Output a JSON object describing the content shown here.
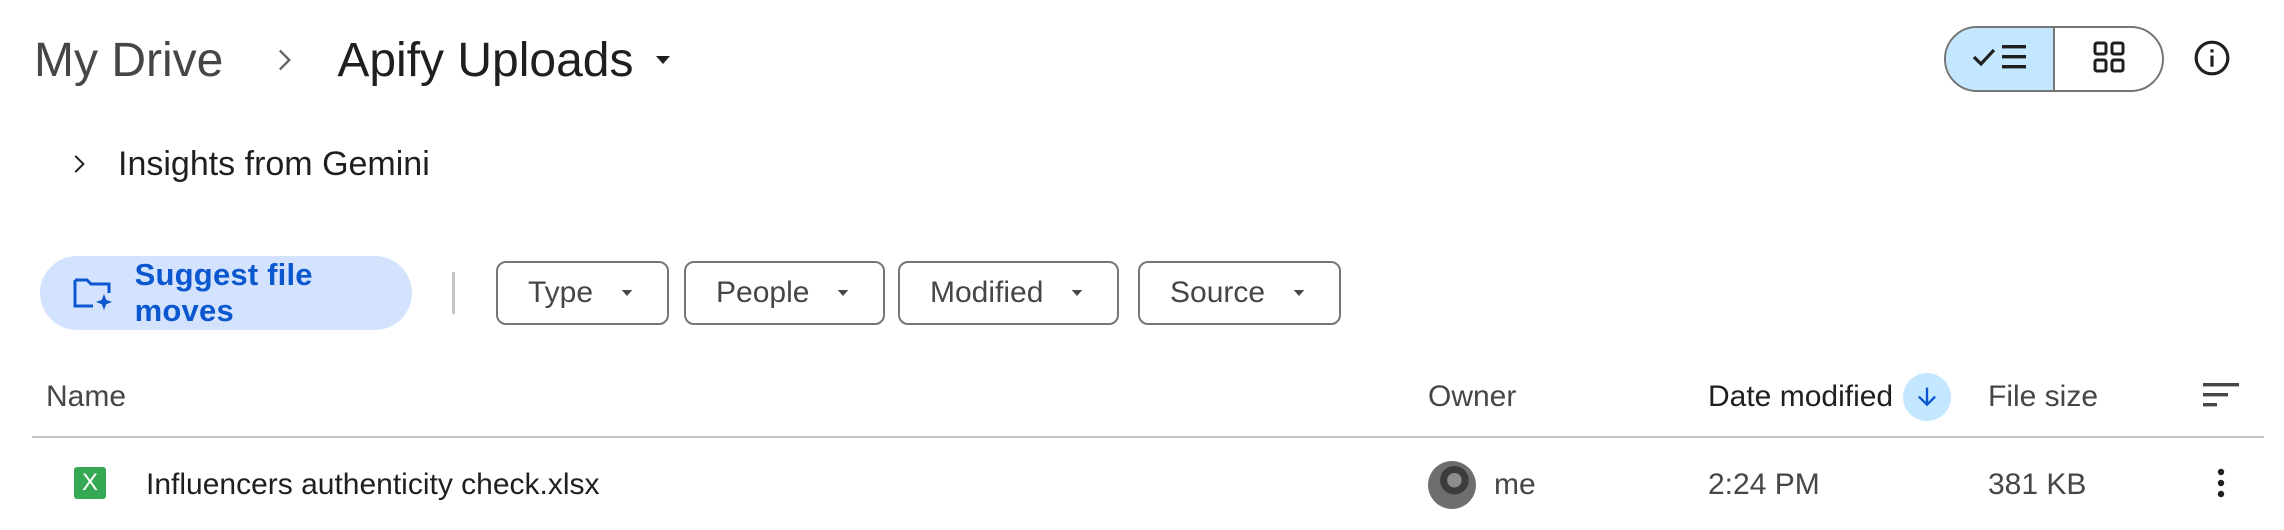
{
  "breadcrumb": {
    "root": "My Drive",
    "current": "Apify Uploads"
  },
  "view": {
    "list_icon": "check-list-icon",
    "grid_icon": "grid-icon",
    "selected": "list",
    "info_icon": "info-icon"
  },
  "insights": {
    "label": "Insights from Gemini"
  },
  "filters": {
    "suggest_label": "Suggest file moves",
    "chips": [
      "Type",
      "People",
      "Modified",
      "Source"
    ]
  },
  "table": {
    "headers": {
      "name": "Name",
      "owner": "Owner",
      "date_modified": "Date modified",
      "file_size": "File size"
    },
    "sort": {
      "column": "date_modified",
      "direction": "descending"
    },
    "rows": [
      {
        "icon": "xlsx-icon",
        "icon_letter": "X",
        "name": "Influencers authenticity check.xlsx",
        "owner": "me",
        "date_modified": "2:24 PM",
        "file_size": "381 KB"
      }
    ]
  },
  "colors": {
    "accent": "#0b57d0",
    "selected_bg": "#c2e7ff",
    "suggest_bg": "#d3e3fd",
    "xlsx_green": "#34a853"
  }
}
